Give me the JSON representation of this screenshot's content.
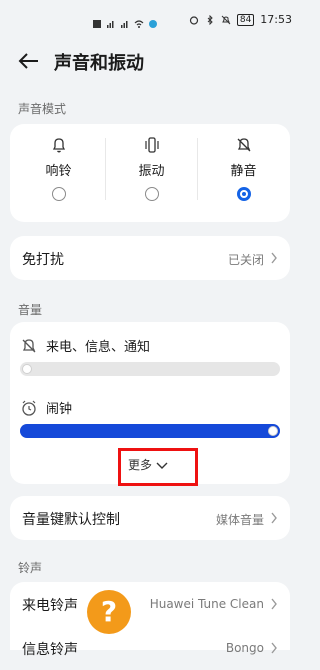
{
  "statusbar": {
    "time": "17:53",
    "battery": "84",
    "network_text": "46"
  },
  "header": {
    "title": "声音和振动"
  },
  "sections": {
    "mode_label": "声音模式",
    "volume_label": "音量",
    "ringtone_label": "铃声"
  },
  "modes": [
    {
      "label": "响铃",
      "selected": false
    },
    {
      "label": "振动",
      "selected": false
    },
    {
      "label": "静音",
      "selected": true
    }
  ],
  "dnd": {
    "title": "免打扰",
    "value": "已关闭"
  },
  "volume": {
    "call_label": "来电、信息、通知",
    "call_level": 0,
    "alarm_label": "闹钟",
    "alarm_level": 1.0,
    "more_label": "更多"
  },
  "volume_key": {
    "title": "音量键默认控制",
    "value": "媒体音量"
  },
  "ringtone_rows": [
    {
      "title": "来电铃声",
      "value": "Huawei Tune Clean"
    },
    {
      "title": "信息铃声",
      "value": "Bongo"
    }
  ],
  "colors": {
    "accent": "#1463e6",
    "slider": "#1549d9",
    "highlight": "#e11111",
    "help": "#f39a1a"
  }
}
